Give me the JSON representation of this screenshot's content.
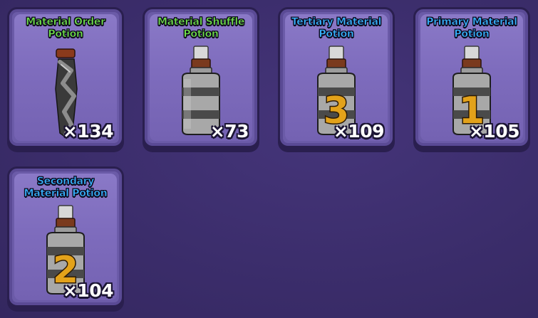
{
  "inventory": {
    "items": [
      {
        "name": "Material Order\nPotion",
        "name_line1": "Material Order",
        "name_line2": "Potion",
        "count": "×134",
        "title_color": "green",
        "icon": "twisted-vial-icon"
      },
      {
        "name_line1": "Material Shuffle",
        "name_line2": "Potion",
        "count": "×73",
        "title_color": "green",
        "icon": "striped-bottle-icon"
      },
      {
        "name_line1": "Tertiary Material",
        "name_line2": "Potion",
        "count": "×109",
        "title_color": "blue",
        "icon": "bottle-number-3-icon",
        "number": "3"
      },
      {
        "name_line1": "Primary Material",
        "name_line2": "Potion",
        "count": "×105",
        "title_color": "blue",
        "icon": "bottle-number-1-icon",
        "number": "1"
      },
      {
        "name_line1": "Secondary",
        "name_line2": "Material Potion",
        "count": "×104",
        "title_color": "blue",
        "icon": "bottle-number-2-icon",
        "number": "2"
      }
    ]
  },
  "colors": {
    "background": "#3d2f6e",
    "card": "#7e6cbd",
    "title_green": "#6fe04a",
    "title_blue": "#37b3ff",
    "number_gold": "#e3a21a"
  }
}
